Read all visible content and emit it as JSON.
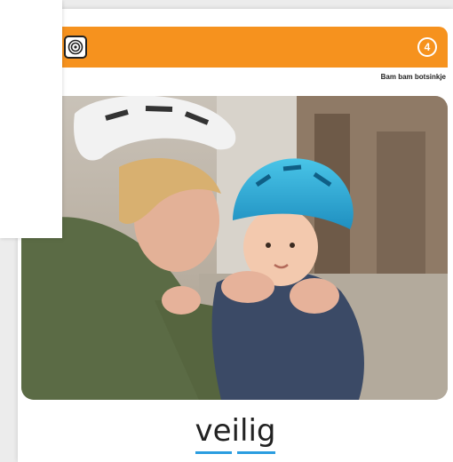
{
  "card": {
    "page_number": "4",
    "subtitle": "Bam bam botsinkje",
    "word": "veilig",
    "accent_color": "#f6921e",
    "underline_color": "#2a9de0",
    "header_icon": "spiral-icon"
  },
  "photo": {
    "icon": "photo-parent-helping-child-with-bike-helmet"
  }
}
